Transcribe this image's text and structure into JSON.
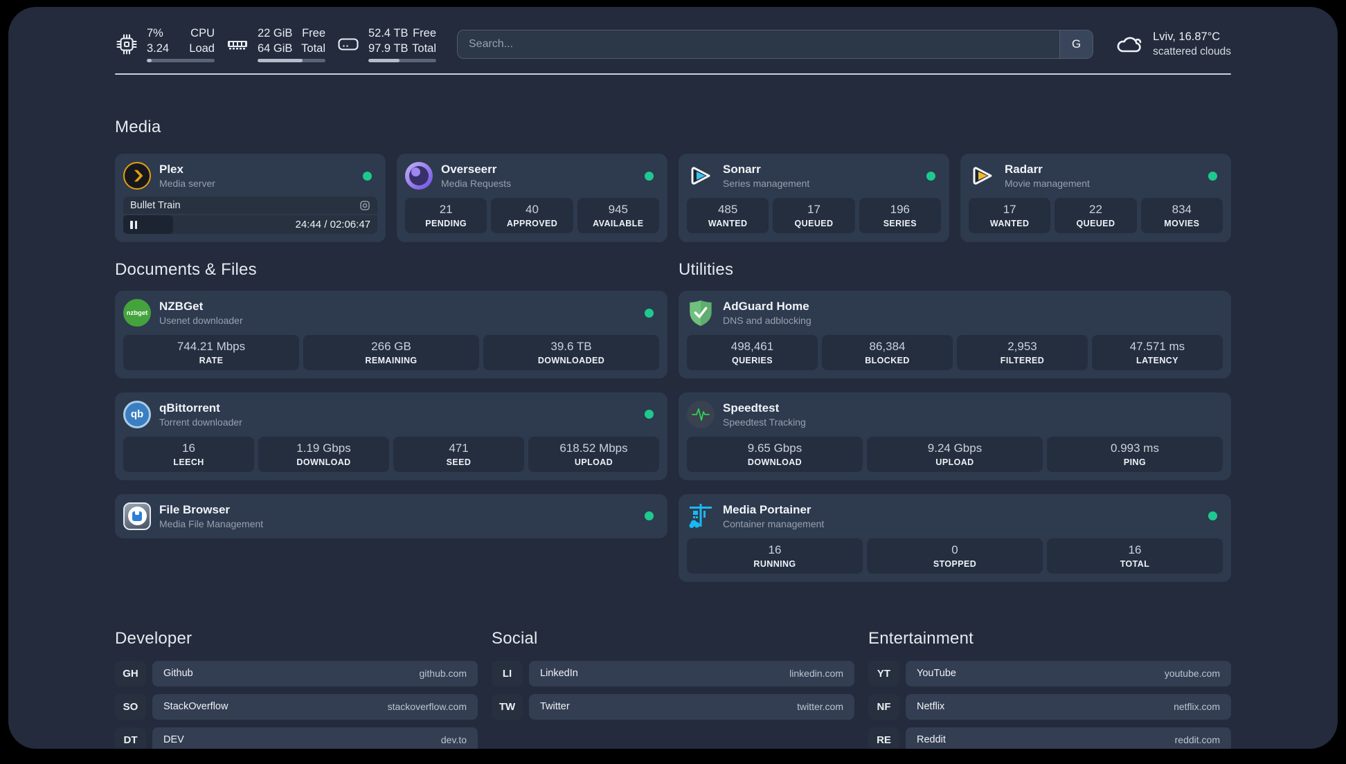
{
  "header": {
    "cpu": {
      "value_top": "7%",
      "value_bottom": "3.24",
      "label_top": "CPU",
      "label_bottom": "Load",
      "progress": 7
    },
    "memory": {
      "value_top": "22 GiB",
      "value_bottom": "64 GiB",
      "label_top": "Free",
      "label_bottom": "Total",
      "progress": 66
    },
    "disk": {
      "value_top": "52.4 TB",
      "value_bottom": "97.9 TB",
      "label_top": "Free",
      "label_bottom": "Total",
      "progress": 46
    },
    "search": {
      "placeholder": "Search...",
      "provider_label": "G"
    },
    "weather": {
      "location_temp": "Lviv, 16.87°C",
      "condition": "scattered clouds"
    }
  },
  "media": {
    "title": "Media",
    "plex": {
      "name": "Plex",
      "description": "Media server",
      "now_playing": {
        "title": "Bullet Train",
        "elapsed": "24:44",
        "separator": " / ",
        "total": "02:06:47",
        "progress": 19.5
      }
    },
    "overseerr": {
      "name": "Overseerr",
      "description": "Media Requests",
      "stats": [
        {
          "value": "21",
          "label": "PENDING"
        },
        {
          "value": "40",
          "label": "APPROVED"
        },
        {
          "value": "945",
          "label": "AVAILABLE"
        }
      ]
    },
    "sonarr": {
      "name": "Sonarr",
      "description": "Series management",
      "stats": [
        {
          "value": "485",
          "label": "WANTED"
        },
        {
          "value": "17",
          "label": "QUEUED"
        },
        {
          "value": "196",
          "label": "SERIES"
        }
      ]
    },
    "radarr": {
      "name": "Radarr",
      "description": "Movie management",
      "stats": [
        {
          "value": "17",
          "label": "WANTED"
        },
        {
          "value": "22",
          "label": "QUEUED"
        },
        {
          "value": "834",
          "label": "MOVIES"
        }
      ]
    }
  },
  "documents": {
    "title": "Documents & Files",
    "nzbget": {
      "name": "NZBGet",
      "description": "Usenet downloader",
      "icon_text": "nzbget",
      "stats": [
        {
          "value": "744.21 Mbps",
          "label": "RATE"
        },
        {
          "value": "266 GB",
          "label": "REMAINING"
        },
        {
          "value": "39.6 TB",
          "label": "DOWNLOADED"
        }
      ]
    },
    "qbittorrent": {
      "name": "qBittorrent",
      "description": "Torrent downloader",
      "icon_text": "qb",
      "stats": [
        {
          "value": "16",
          "label": "LEECH"
        },
        {
          "value": "1.19 Gbps",
          "label": "DOWNLOAD"
        },
        {
          "value": "471",
          "label": "SEED"
        },
        {
          "value": "618.52 Mbps",
          "label": "UPLOAD"
        }
      ]
    },
    "filebrowser": {
      "name": "File Browser",
      "description": "Media File Management"
    }
  },
  "utilities": {
    "title": "Utilities",
    "adguard": {
      "name": "AdGuard Home",
      "description": "DNS and adblocking",
      "stats": [
        {
          "value": "498,461",
          "label": "QUERIES"
        },
        {
          "value": "86,384",
          "label": "BLOCKED"
        },
        {
          "value": "2,953",
          "label": "FILTERED"
        },
        {
          "value": "47.571 ms",
          "label": "LATENCY"
        }
      ]
    },
    "speedtest": {
      "name": "Speedtest",
      "description": "Speedtest Tracking",
      "stats": [
        {
          "value": "9.65 Gbps",
          "label": "DOWNLOAD"
        },
        {
          "value": "9.24 Gbps",
          "label": "UPLOAD"
        },
        {
          "value": "0.993 ms",
          "label": "PING"
        }
      ]
    },
    "portainer": {
      "name": "Media Portainer",
      "description": "Container management",
      "stats": [
        {
          "value": "16",
          "label": "RUNNING"
        },
        {
          "value": "0",
          "label": "STOPPED"
        },
        {
          "value": "16",
          "label": "TOTAL"
        }
      ]
    }
  },
  "bookmarks": {
    "developer": {
      "title": "Developer",
      "items": [
        {
          "abbr": "GH",
          "name": "Github",
          "url": "github.com"
        },
        {
          "abbr": "SO",
          "name": "StackOverflow",
          "url": "stackoverflow.com"
        },
        {
          "abbr": "DT",
          "name": "DEV",
          "url": "dev.to"
        }
      ]
    },
    "social": {
      "title": "Social",
      "items": [
        {
          "abbr": "LI",
          "name": "LinkedIn",
          "url": "linkedin.com"
        },
        {
          "abbr": "TW",
          "name": "Twitter",
          "url": "twitter.com"
        }
      ]
    },
    "entertainment": {
      "title": "Entertainment",
      "items": [
        {
          "abbr": "YT",
          "name": "YouTube",
          "url": "youtube.com"
        },
        {
          "abbr": "NF",
          "name": "Netflix",
          "url": "netflix.com"
        },
        {
          "abbr": "RE",
          "name": "Reddit",
          "url": "reddit.com"
        }
      ]
    }
  },
  "colors": {
    "status_online": "#1ec98e",
    "accent_plex": "#e5a00d",
    "background": "#232b3c",
    "card": "#2e3a4e"
  }
}
